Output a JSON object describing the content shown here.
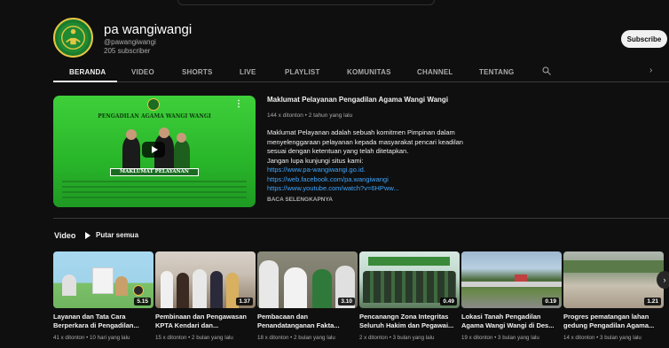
{
  "channel": {
    "name": "pa wangiwangi",
    "handle": "@pawangiwangi",
    "subscribers": "205 subscriber",
    "subscribe_label": "Subscribe"
  },
  "tabs": [
    {
      "label": "BERANDA",
      "active": true
    },
    {
      "label": "VIDEO"
    },
    {
      "label": "SHORTS"
    },
    {
      "label": "LIVE"
    },
    {
      "label": "PLAYLIST"
    },
    {
      "label": "KOMUNITAS"
    },
    {
      "label": "CHANNEL"
    },
    {
      "label": "TENTANG"
    }
  ],
  "featured": {
    "thumb_title": "PENGADILAN AGAMA WANGI WANGI",
    "thumb_banner": "MAKLUMAT PELAYANAN",
    "title": "Maklumat Pelayanan Pengadilan Agama Wangi Wangi",
    "meta": "144 x ditonton • 2 tahun yang lalu",
    "desc_lines": [
      "Maklumat Pelayanan adalah sebuah komitmen Pimpinan dalam",
      "menyelenggaraan pelayanan kepada masyarakat pencari keadilan",
      "sesuai dengan ketentuan yang telah ditetapkan.",
      "Jangan lupa kunjungi situs kami:"
    ],
    "links": [
      "https://www.pa-wangiwangi.go.id.",
      "https://web.facebook.com/pa.wangiwangi",
      "https://www.youtube.com/watch?v=6HPww..."
    ],
    "more_label": "BACA SELENGKAPNYA"
  },
  "section": {
    "title": "Video",
    "play_all": "Putar semua"
  },
  "videos": [
    {
      "title1": "Layanan dan Tata Cara",
      "title2": "Berperkara di Pengadilan...",
      "meta": "41 x ditonton • 10 hari yang lalu",
      "duration": "5.15"
    },
    {
      "title1": "Pembinaan dan Pengawasan",
      "title2": "KPTA Kendari dan...",
      "meta": "15 x ditonton • 2 bulan yang lalu",
      "duration": "1.37"
    },
    {
      "title1": "Pembacaan dan",
      "title2": "Penandatanganan Fakta...",
      "meta": "18 x ditonton • 2 bulan yang lalu",
      "duration": "3.10"
    },
    {
      "title1": "Pencanangn Zona Integritas",
      "title2": "Seluruh Hakim dan Pegawai...",
      "meta": "2 x ditonton • 3 bulan yang lalu",
      "duration": "0.49"
    },
    {
      "title1": "Lokasi Tanah Pengadilan",
      "title2": "Agama Wangi Wangi di Des...",
      "meta": "19 x ditonton • 3 bulan yang lalu",
      "duration": "0.19"
    },
    {
      "title1": "Progres pematangan lahan",
      "title2": "gedung Pengadilan Agama...",
      "meta": "14 x ditonton • 3 bulan yang lalu",
      "duration": "1.21"
    }
  ],
  "colors": {
    "background": "#0f0f0f",
    "link": "#3ea6ff",
    "text_secondary": "#aaaaaa"
  }
}
